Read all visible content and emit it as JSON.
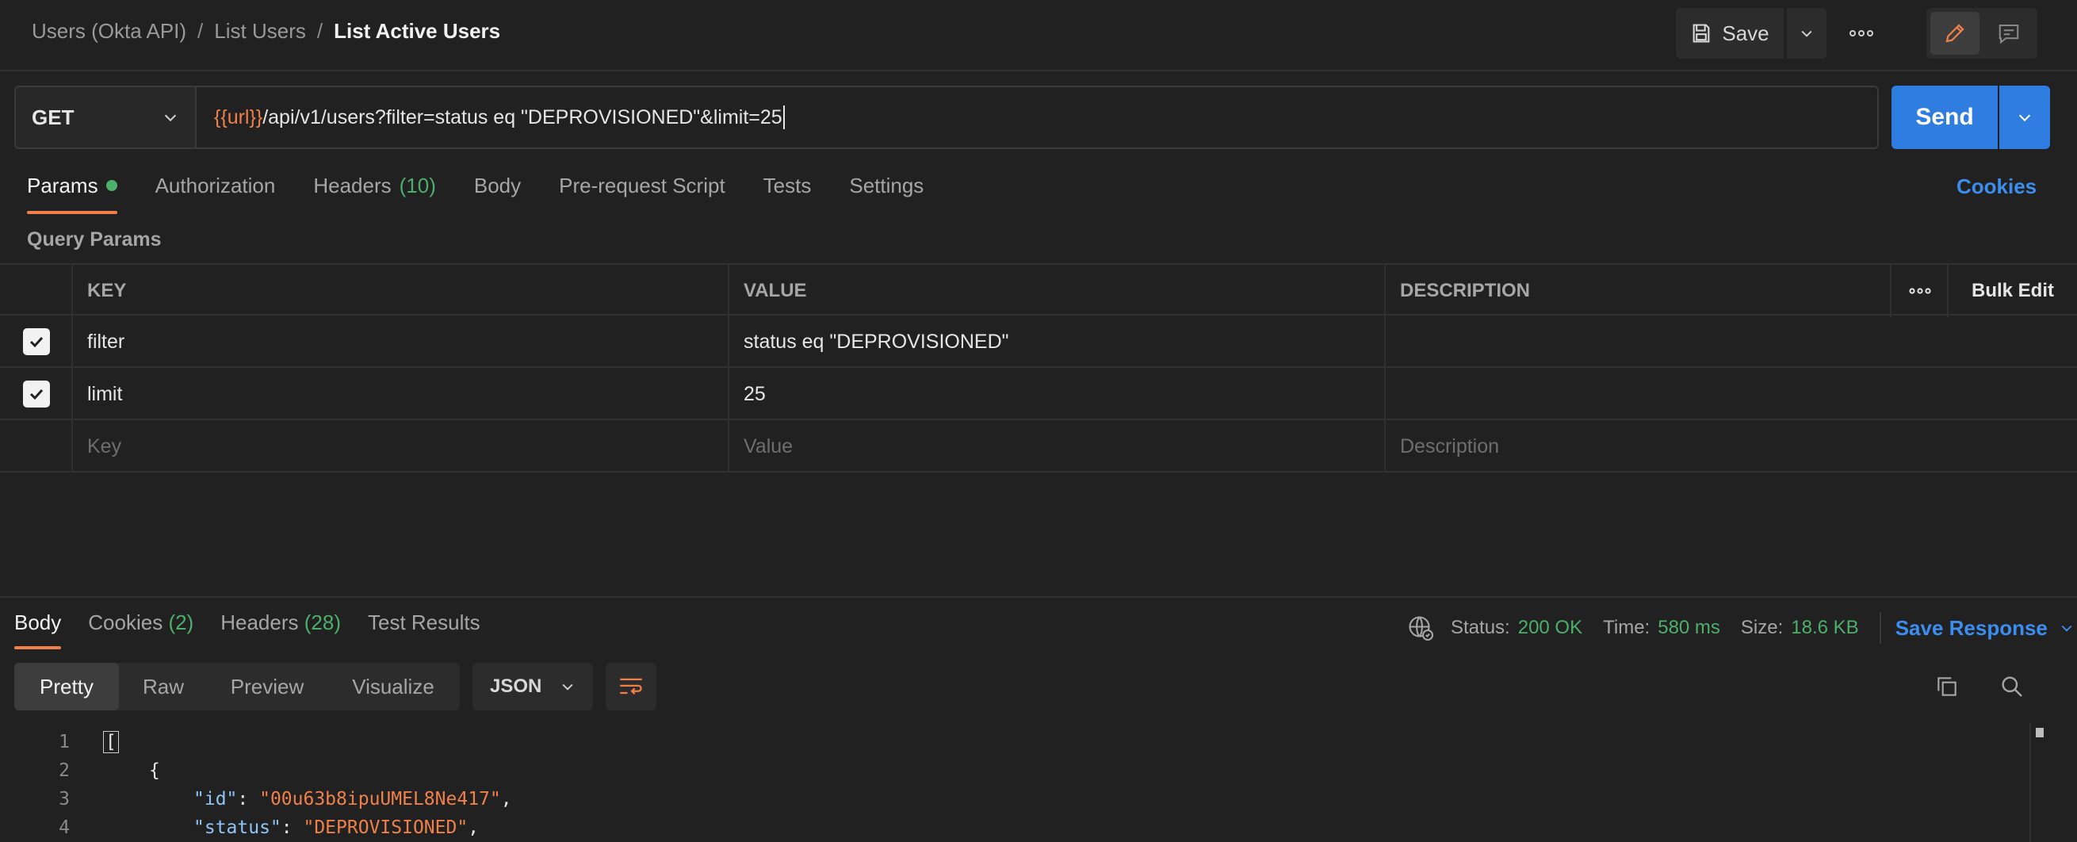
{
  "breadcrumb": {
    "items": [
      "Users (Okta API)",
      "List Users"
    ],
    "separator": "/",
    "current": "List Active Users"
  },
  "header": {
    "save_label": "Save"
  },
  "request": {
    "method": "GET",
    "url_var": "{{url}}",
    "url_rest": "/api/v1/users?filter=status eq \"DEPROVISIONED\"&limit=25",
    "send_label": "Send"
  },
  "request_tabs": {
    "params": "Params",
    "authorization": "Authorization",
    "headers": "Headers",
    "headers_count": "(10)",
    "body": "Body",
    "prerequest": "Pre-request Script",
    "tests": "Tests",
    "settings": "Settings",
    "cookies": "Cookies"
  },
  "query_params": {
    "title": "Query Params",
    "columns": {
      "key": "KEY",
      "value": "VALUE",
      "description": "DESCRIPTION",
      "bulk_edit": "Bulk Edit"
    },
    "rows": [
      {
        "key": "filter",
        "value": "status eq \"DEPROVISIONED\"",
        "description": ""
      },
      {
        "key": "limit",
        "value": "25",
        "description": ""
      }
    ],
    "placeholders": {
      "key": "Key",
      "value": "Value",
      "description": "Description"
    }
  },
  "response_tabs": {
    "body": "Body",
    "cookies": "Cookies",
    "cookies_count": "(2)",
    "headers": "Headers",
    "headers_count": "(28)",
    "test_results": "Test Results"
  },
  "response_meta": {
    "status_label": "Status:",
    "status_value": "200 OK",
    "time_label": "Time:",
    "time_value": "580 ms",
    "size_label": "Size:",
    "size_value": "18.6 KB",
    "save_response": "Save Response"
  },
  "view_modes": [
    "Pretty",
    "Raw",
    "Preview",
    "Visualize"
  ],
  "format": "JSON",
  "code": {
    "line_numbers": [
      "1",
      "2",
      "3",
      "4"
    ],
    "line1": "[",
    "line2": "{",
    "line3_key": "\"id\"",
    "line3_val": "\"00u63b8ipuUMEL8Ne417\"",
    "line4_key": "\"status\"",
    "line4_val": "\"DEPROVISIONED\"",
    "colon": ": ",
    "comma": ","
  },
  "colors": {
    "accent": "#f0804a",
    "primary": "#2f7de1",
    "success": "#4caf6a",
    "background": "#212121"
  },
  "icons": [
    "save-icon",
    "chevron-down-icon",
    "more-icon",
    "pencil-icon",
    "comment-icon",
    "globe-icon",
    "check-icon",
    "wrap-lines-icon",
    "copy-icon",
    "search-icon"
  ]
}
